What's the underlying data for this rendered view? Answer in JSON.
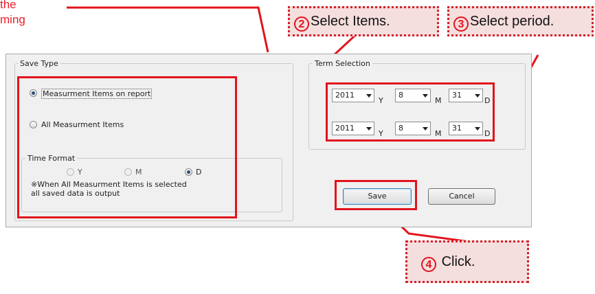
{
  "annotation": {
    "note_line1": "the",
    "note_line2": "ming",
    "callout2": {
      "number": "2",
      "text": "Select Items."
    },
    "callout3": {
      "number": "3",
      "text": "Select period."
    },
    "callout4": {
      "number": "4",
      "text": "Click."
    },
    "highlight_color": "#e2131b",
    "callout_fill": "#f5dede"
  },
  "save_type": {
    "title": "Save Type",
    "options": [
      {
        "label": "Measurment Items on report",
        "selected": true
      },
      {
        "label": "All Measurment Items",
        "selected": false
      }
    ]
  },
  "time_format": {
    "title": "Time Format",
    "options": [
      {
        "label": "Y",
        "selected": false
      },
      {
        "label": "M",
        "selected": false
      },
      {
        "label": "D",
        "selected": true
      }
    ],
    "note_line1": "※When All Measurment Items is selected",
    "note_line2": "all saved data is output"
  },
  "term_selection": {
    "title": "Term Selection",
    "start": {
      "year": "2011",
      "month": "8",
      "day": "31"
    },
    "end": {
      "year": "2011",
      "month": "8",
      "day": "31"
    },
    "units": {
      "year": "Y",
      "month": "M",
      "day": "D"
    }
  },
  "buttons": {
    "save": "Save",
    "cancel": "Cancel"
  }
}
